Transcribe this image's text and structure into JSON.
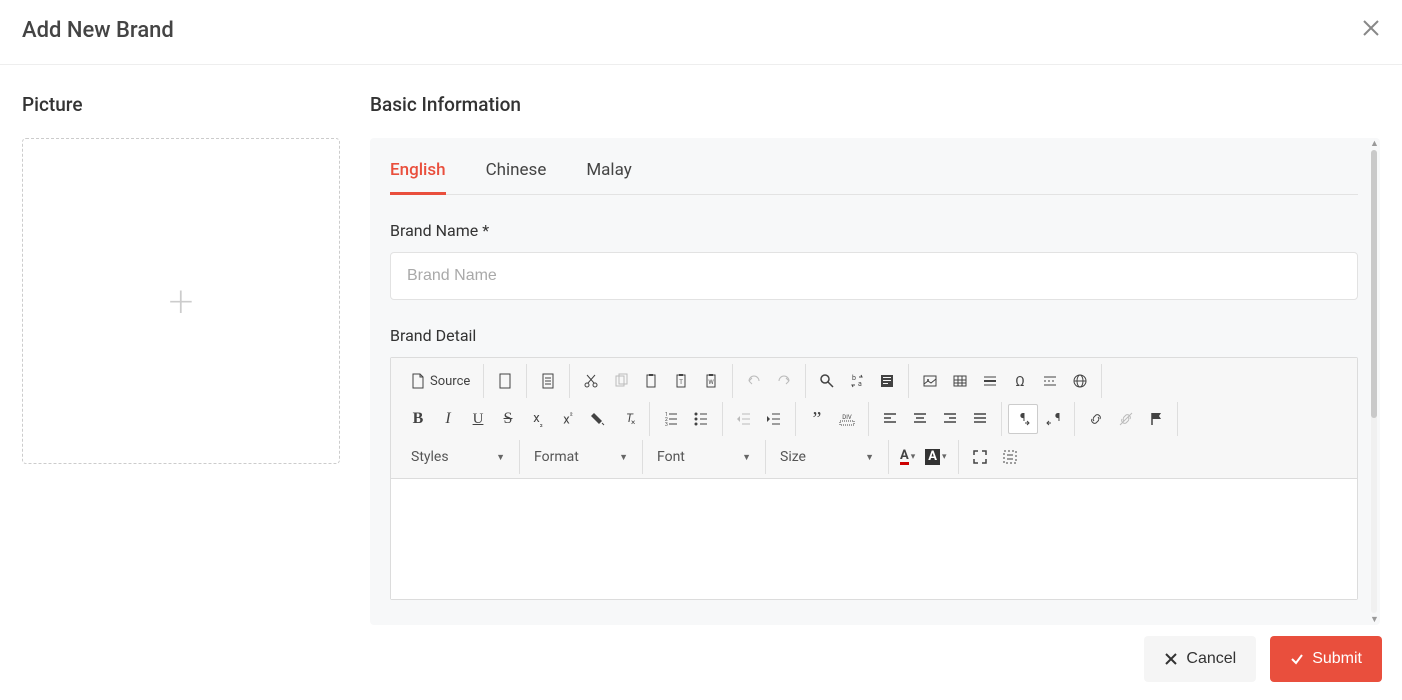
{
  "header": {
    "title": "Add New Brand"
  },
  "sections": {
    "picture": "Picture",
    "basic_info": "Basic Information"
  },
  "tabs": [
    {
      "label": "English",
      "active": true
    },
    {
      "label": "Chinese",
      "active": false
    },
    {
      "label": "Malay",
      "active": false
    }
  ],
  "fields": {
    "brand_name": {
      "label": "Brand Name *",
      "placeholder": "Brand Name",
      "value": ""
    },
    "brand_detail": {
      "label": "Brand Detail"
    }
  },
  "editor": {
    "source_label": "Source",
    "dropdowns": {
      "styles": "Styles",
      "format": "Format",
      "font": "Font",
      "size": "Size"
    },
    "text_color_letter": "A",
    "bg_color_letter": "A"
  },
  "footer": {
    "cancel": "Cancel",
    "submit": "Submit"
  }
}
